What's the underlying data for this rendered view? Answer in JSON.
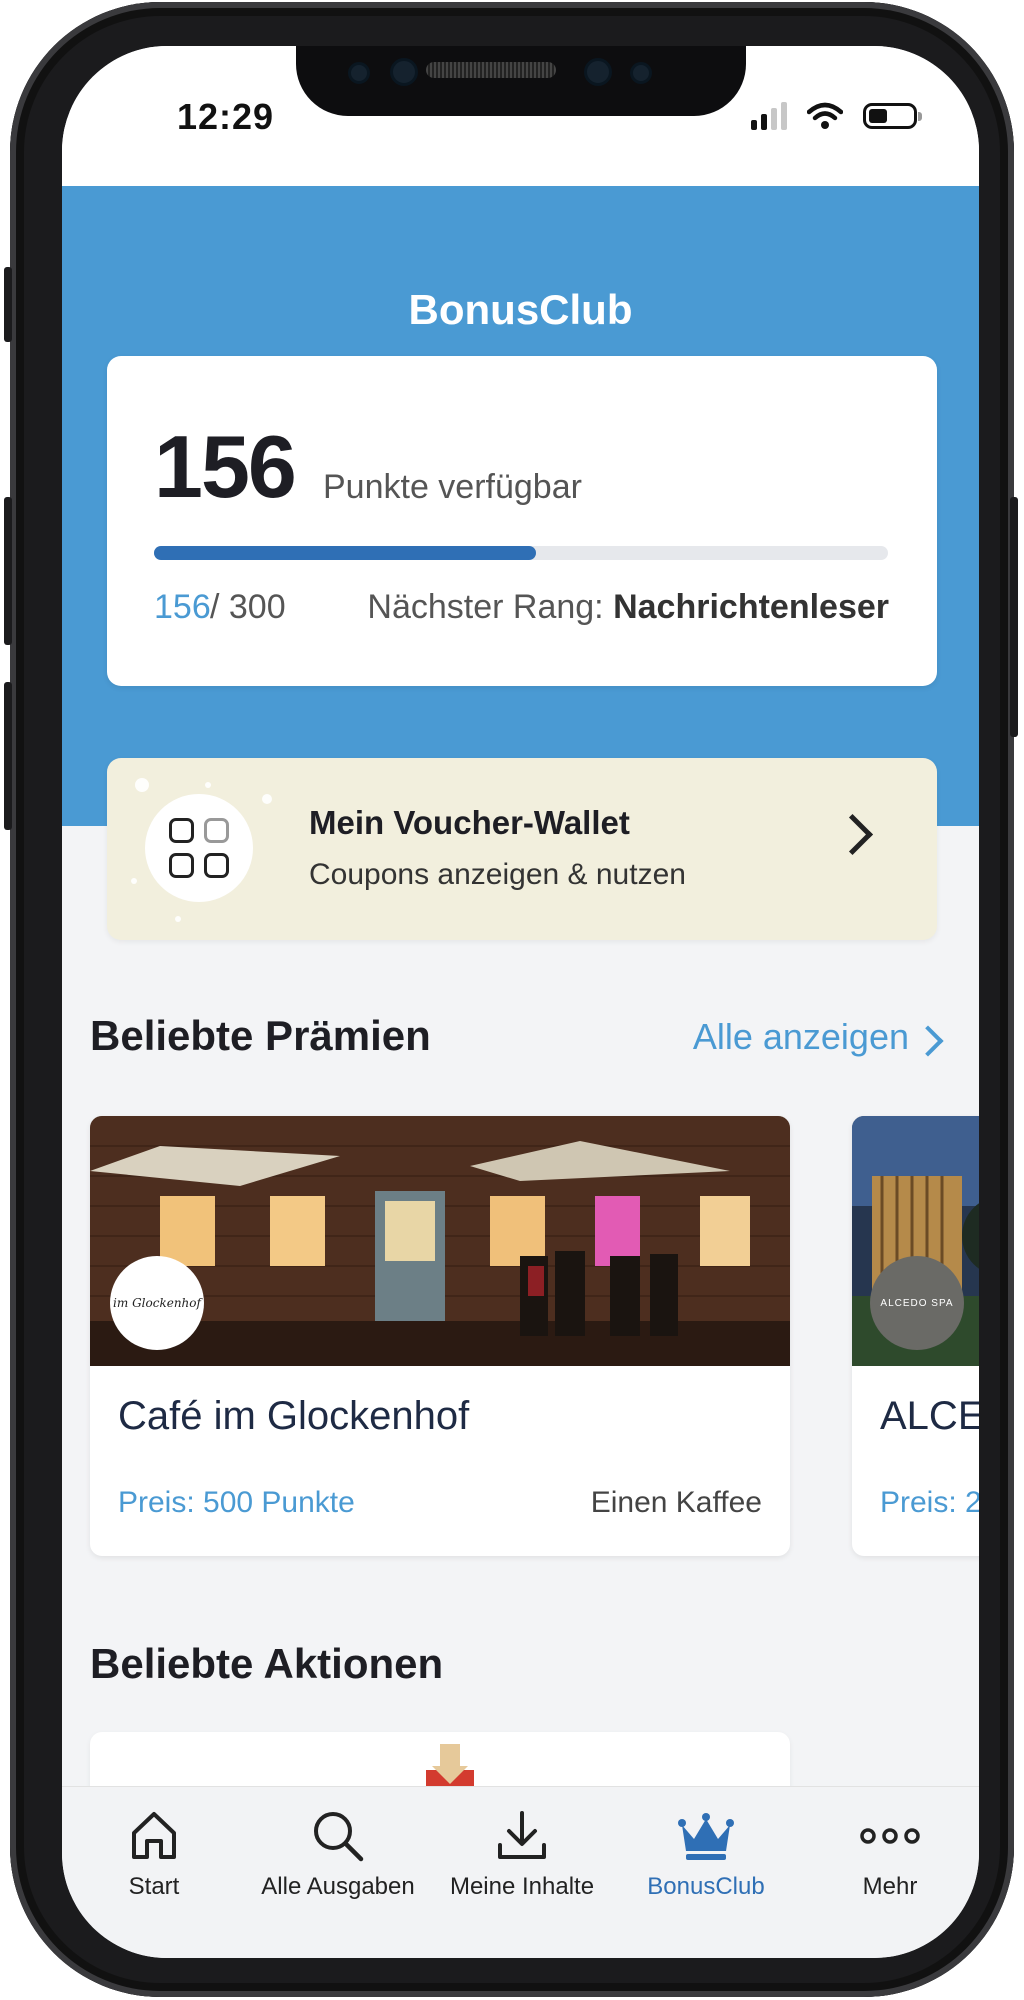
{
  "status_bar": {
    "time": "12:29"
  },
  "header": {
    "title": "BonusClub"
  },
  "points": {
    "value": "156",
    "label": "Punkte verfügbar",
    "current": "156",
    "separator_total": "/ 300",
    "progress_fraction": 0.52,
    "next_rank_label": "Nächster Rang:",
    "next_rank_value": "Nachrichtenleser"
  },
  "wallet": {
    "title": "Mein Voucher-Wallet",
    "subtitle": "Coupons anzeigen & nutzen"
  },
  "popular_rewards": {
    "title": "Beliebte Prämien",
    "see_all": "Alle anzeigen",
    "cards": [
      {
        "logo_text": "im Glockenhof",
        "name": "Café im Glockenhof",
        "price": "Preis: 500 Punkte",
        "description": "Einen Kaffee"
      },
      {
        "logo_text": "ALCEDO SPA",
        "name": "ALCE",
        "price": "Preis: 2.",
        "description": ""
      }
    ]
  },
  "popular_actions": {
    "title": "Beliebte Aktionen"
  },
  "tabbar": {
    "tabs": [
      {
        "label": "Start",
        "icon": "home-icon"
      },
      {
        "label": "Alle Ausgaben",
        "icon": "search-icon"
      },
      {
        "label": "Meine Inhalte",
        "icon": "download-icon"
      },
      {
        "label": "BonusClub",
        "icon": "crown-icon"
      },
      {
        "label": "Mehr",
        "icon": "more-icon"
      }
    ],
    "active_color": "#2f6fb5"
  },
  "colors": {
    "brand_blue": "#4a9ad3",
    "progress_fill": "#2f6fb5",
    "wallet_bg": "#f2efdd"
  }
}
